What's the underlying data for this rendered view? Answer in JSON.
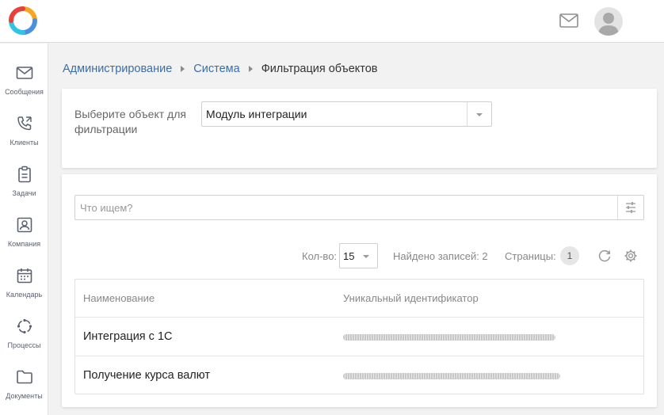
{
  "header": {
    "logo_icon": "app-logo-ring",
    "mail_icon": "envelope-icon",
    "avatar_icon": "user-avatar"
  },
  "sidebar": {
    "items": [
      {
        "label": "Сообщения",
        "icon": "envelope-icon"
      },
      {
        "label": "Клиенты",
        "icon": "phone-icon"
      },
      {
        "label": "Задачи",
        "icon": "clipboard-icon"
      },
      {
        "label": "Компания",
        "icon": "id-card-icon"
      },
      {
        "label": "Календарь",
        "icon": "calendar-icon"
      },
      {
        "label": "Процессы",
        "icon": "cycle-icon"
      },
      {
        "label": "Документы",
        "icon": "folder-icon"
      }
    ]
  },
  "breadcrumb": {
    "items": [
      "Администрирование",
      "Система"
    ],
    "current": "Фильтрация объектов"
  },
  "object_filter": {
    "label": "Выберите объект для фильтрации",
    "selected": "Модуль интеграции"
  },
  "search": {
    "placeholder": "Что ищем?",
    "value": ""
  },
  "toolbar": {
    "qty_label": "Кол-во:",
    "qty_value": "15",
    "found_label": "Найдено записей: 2",
    "pages_label": "Страницы:",
    "current_page": "1"
  },
  "table": {
    "columns": [
      "Наименование",
      "Уникальный идентификатор"
    ],
    "rows": [
      {
        "name": "Интеграция с 1С",
        "uid_redacted": true
      },
      {
        "name": "Получение курса валют",
        "uid_redacted": true
      }
    ]
  },
  "colors": {
    "link": "#3a6ea8",
    "sidebar_icon": "#5a6170",
    "background": "#f2f2f2"
  }
}
